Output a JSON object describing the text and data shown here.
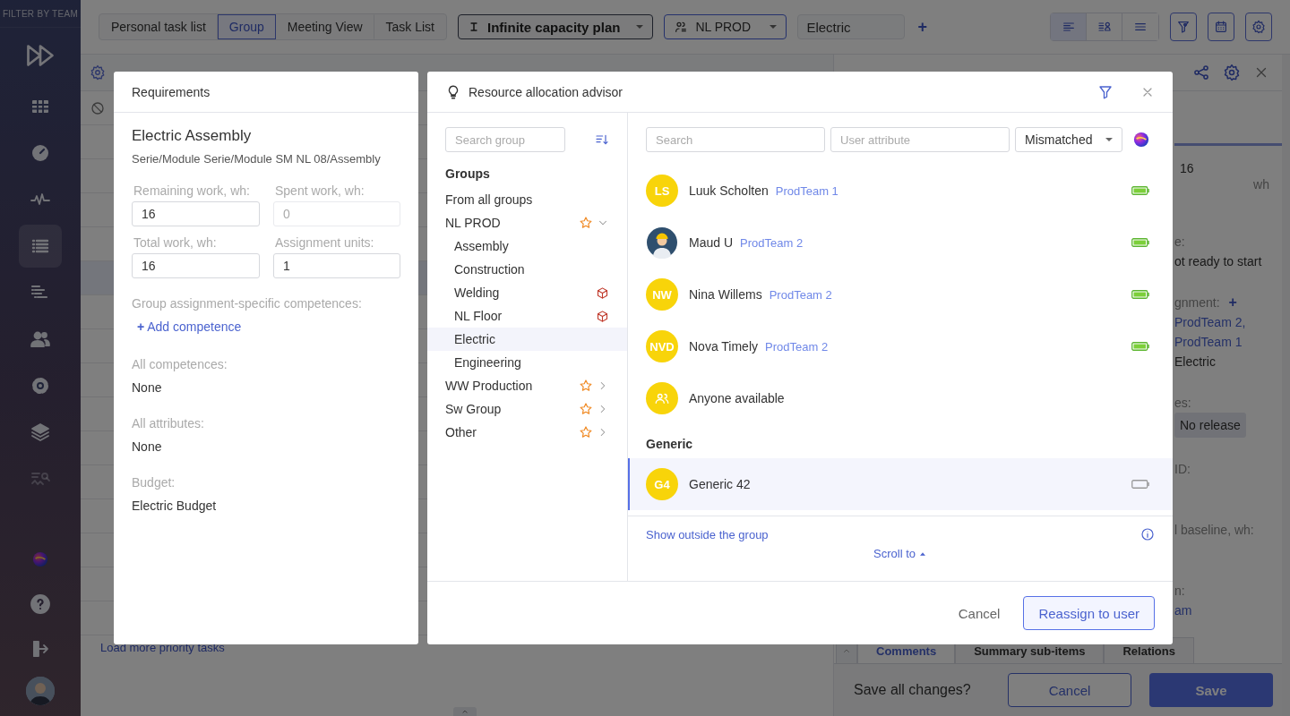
{
  "sidebar": {
    "header": "FILTER BY TEAM",
    "items": [
      {
        "selected": false,
        "disabled": false
      },
      {
        "selected": false,
        "disabled": false
      },
      {
        "selected": false,
        "disabled": false
      },
      {
        "selected": true,
        "disabled": false
      },
      {
        "selected": false,
        "disabled": false
      },
      {
        "selected": false,
        "disabled": false
      },
      {
        "selected": false,
        "disabled": false
      },
      {
        "selected": false,
        "disabled": false
      },
      {
        "selected": false,
        "disabled": true
      }
    ],
    "bottom_items": [
      {
        "kind": "orb"
      },
      {
        "kind": "help"
      },
      {
        "kind": "logout"
      }
    ]
  },
  "toolbar": {
    "views": [
      {
        "label": "Personal task list",
        "selected": false
      },
      {
        "label": "Group",
        "selected": true
      },
      {
        "label": "Meeting View",
        "selected": false
      },
      {
        "label": "Task List",
        "selected": false
      }
    ],
    "plan": "Infinite capacity plan",
    "team": "NL PROD",
    "subgroup": "Electric",
    "add": "+",
    "layouts": [
      {
        "selected": true
      },
      {
        "selected": false
      },
      {
        "selected": false
      }
    ]
  },
  "task_list": {
    "load_more": "Load more priority tasks"
  },
  "task_panel": {
    "sections": [
      {
        "kind": "amount",
        "value": "16",
        "unit": "wh"
      },
      {
        "kind": "field",
        "label": "e:",
        "values": [
          {
            "kind": "text",
            "text": "ot ready to start"
          }
        ]
      },
      {
        "kind": "field",
        "label": "gnment:",
        "add": "+",
        "values": [
          {
            "kind": "link",
            "text": "ProdTeam 2,"
          },
          {
            "kind": "link",
            "text": "ProdTeam 1"
          },
          {
            "kind": "text",
            "text": "Electric"
          }
        ]
      },
      {
        "kind": "field",
        "label": "es:",
        "values": [
          {
            "kind": "tag",
            "text": "No release"
          }
        ]
      },
      {
        "kind": "field",
        "label": "ID:"
      },
      {
        "kind": "field",
        "label": "l baseline, wh:"
      },
      {
        "kind": "field",
        "label": "n:",
        "values": [
          {
            "kind": "link",
            "text": "am"
          }
        ]
      }
    ],
    "tabs": [
      {
        "label": "Comments",
        "selected": true
      },
      {
        "label": "Summary sub-items",
        "selected": false
      },
      {
        "label": "Relations",
        "selected": false
      }
    ],
    "save_prompt": "Save all changes?",
    "cancel": "Cancel",
    "save": "Save"
  },
  "requirements": {
    "title": "Requirements",
    "task": "Electric Assembly",
    "path": "Serie/Module Serie/Module SM NL 08/Assembly",
    "fields": [
      {
        "label": "Remaining work, wh:",
        "value": "16",
        "disabled": false
      },
      {
        "label": "Spent work, wh:",
        "value": "0",
        "disabled": true
      },
      {
        "label": "Total work, wh:",
        "value": "16",
        "disabled": false
      },
      {
        "label": "Assignment units:",
        "value": "1",
        "disabled": false
      }
    ],
    "competences_label": "Group assignment-specific competences:",
    "add_competence_mark": "+",
    "add_competence": "Add competence",
    "info": [
      {
        "label": "All competences:",
        "value": "None"
      },
      {
        "label": "All attributes:",
        "value": "None"
      },
      {
        "label": "Budget:",
        "value": "Electric Budget"
      }
    ]
  },
  "advisor": {
    "title": "Resource allocation advisor",
    "group_search": {
      "placeholder": "Search group"
    },
    "groups_heading": "Groups",
    "groups": [
      {
        "label": "From all groups",
        "selected": false
      },
      {
        "label": "NL PROD",
        "selected": false,
        "starred": true,
        "expanded": true,
        "children": [
          {
            "label": "Assembly",
            "selected": false
          },
          {
            "label": "Construction",
            "selected": false
          },
          {
            "label": "Welding",
            "selected": false,
            "flagged": true
          },
          {
            "label": "NL Floor",
            "selected": false,
            "flagged": true
          },
          {
            "label": "Electric",
            "selected": true
          },
          {
            "label": "Engineering",
            "selected": false
          }
        ]
      },
      {
        "label": "WW Production",
        "selected": false,
        "starred": true,
        "expanded": false
      },
      {
        "label": "Sw Group",
        "selected": false,
        "starred": true,
        "expanded": false
      },
      {
        "label": "Other",
        "selected": false,
        "starred": true,
        "expanded": false
      }
    ],
    "search": {
      "placeholder": "Search"
    },
    "attribute": {
      "placeholder": "User attribute"
    },
    "match_filter": "Mismatched",
    "users": [
      {
        "kind": "initials",
        "initials": "LS",
        "name": "Luuk Scholten",
        "team": "ProdTeam 1",
        "available": true
      },
      {
        "kind": "picture",
        "name": "Maud U",
        "team": "ProdTeam 2",
        "available": true
      },
      {
        "kind": "initials",
        "initials": "NW",
        "name": "Nina Willems",
        "team": "ProdTeam 2",
        "available": true
      },
      {
        "kind": "initials",
        "initials": "NVD",
        "name": "Nova Timely",
        "team": "ProdTeam 2",
        "available": true
      },
      {
        "kind": "anyone",
        "name": "Anyone available"
      }
    ],
    "generic_heading": "Generic",
    "generic": [
      {
        "initials": "G4",
        "name": "Generic 42",
        "available": false,
        "selected": true
      }
    ],
    "show_outside": "Show outside the group",
    "scroll_to": "Scroll to",
    "cancel": "Cancel",
    "reassign": "Reassign to user"
  }
}
